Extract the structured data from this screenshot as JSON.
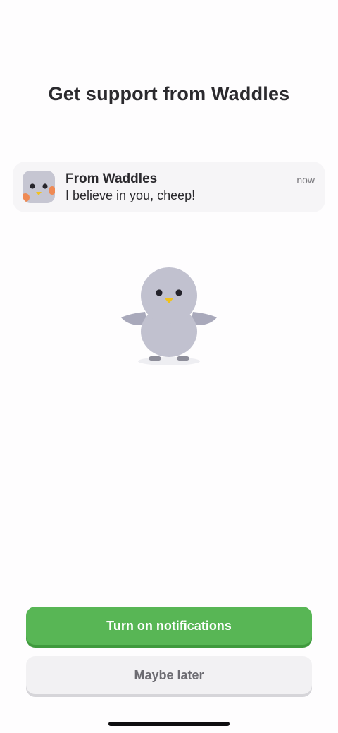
{
  "page": {
    "title": "Get support from Waddles"
  },
  "notification": {
    "sender": "From Waddles",
    "message": "I believe in you, cheep!",
    "time": "now",
    "icon": "waddles-penguin-icon"
  },
  "mascot": {
    "icon": "waddles-penguin-illustration"
  },
  "actions": {
    "primary_label": "Turn on notifications",
    "secondary_label": "Maybe later"
  },
  "colors": {
    "primary_button": "#58b655",
    "secondary_button": "#f2f1f3",
    "penguin_body": "#c1c1cf"
  }
}
